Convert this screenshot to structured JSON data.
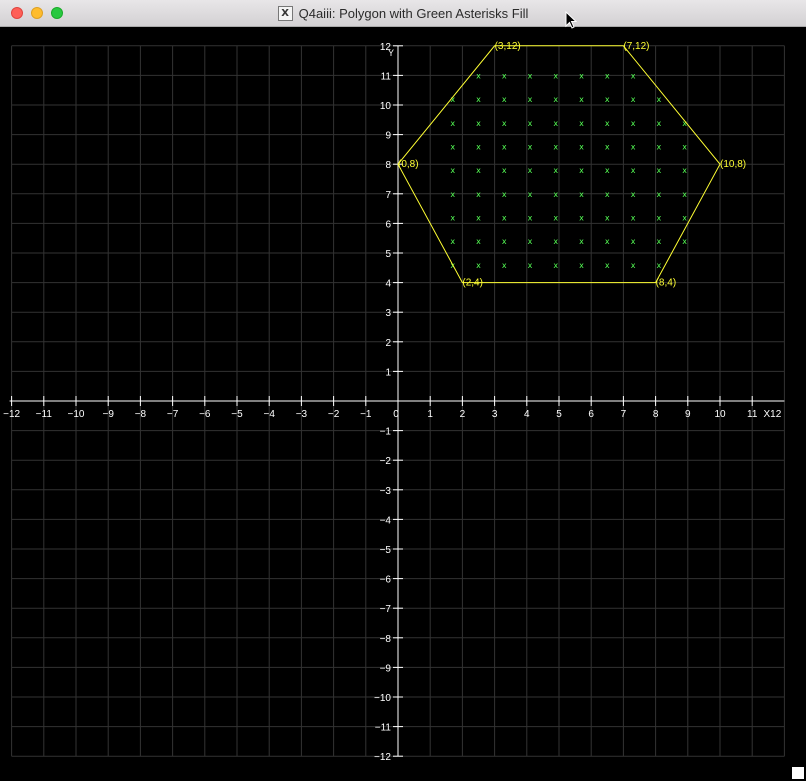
{
  "window": {
    "title": "Q4aiii: Polygon with Green Asterisks Fill",
    "title_icon": "X"
  },
  "colors": {
    "background": "#000000",
    "grid": "#333333",
    "axes": "#ffffff",
    "polygon": "#ffff33",
    "fill_marks": "#55ff55",
    "labels": "#ffffff",
    "vertex_labels": "#ffff33"
  },
  "chart_data": {
    "type": "scatter",
    "xlim": [
      -12,
      12
    ],
    "ylim": [
      -12,
      12
    ],
    "grid": true,
    "x_axis_label": "X12",
    "y_axis_label": "Y",
    "x_ticks": [
      -12,
      -11,
      -10,
      -9,
      -8,
      -7,
      -6,
      -5,
      -4,
      -3,
      -2,
      -1,
      0,
      1,
      2,
      3,
      4,
      5,
      6,
      7,
      8,
      9,
      10,
      11
    ],
    "y_ticks": [
      -12,
      -11,
      -10,
      -9,
      -8,
      -7,
      -6,
      -5,
      -4,
      -3,
      -2,
      -1,
      1,
      2,
      3,
      4,
      5,
      6,
      7,
      8,
      9,
      10,
      11,
      12
    ],
    "polygon": [
      [
        3,
        12
      ],
      [
        7,
        12
      ],
      [
        10,
        8
      ],
      [
        8,
        4
      ],
      [
        2,
        4
      ],
      [
        0,
        8
      ]
    ],
    "vertex_labels": [
      "(3,12)",
      "(7,12)",
      "(10,8)",
      "(8,4)",
      "(2,4)",
      "(0,8)"
    ],
    "fill_marker": "x",
    "fill_points": [
      [
        2.5,
        11
      ],
      [
        3.3,
        11
      ],
      [
        4.1,
        11
      ],
      [
        4.9,
        11
      ],
      [
        5.7,
        11
      ],
      [
        6.5,
        11
      ],
      [
        7.3,
        11
      ],
      [
        1.7,
        10.2
      ],
      [
        2.5,
        10.2
      ],
      [
        3.3,
        10.2
      ],
      [
        4.1,
        10.2
      ],
      [
        4.9,
        10.2
      ],
      [
        5.7,
        10.2
      ],
      [
        6.5,
        10.2
      ],
      [
        7.3,
        10.2
      ],
      [
        8.1,
        10.2
      ],
      [
        1.7,
        9.4
      ],
      [
        2.5,
        9.4
      ],
      [
        3.3,
        9.4
      ],
      [
        4.1,
        9.4
      ],
      [
        4.9,
        9.4
      ],
      [
        5.7,
        9.4
      ],
      [
        6.5,
        9.4
      ],
      [
        7.3,
        9.4
      ],
      [
        8.1,
        9.4
      ],
      [
        8.9,
        9.4
      ],
      [
        1.7,
        8.6
      ],
      [
        2.5,
        8.6
      ],
      [
        3.3,
        8.6
      ],
      [
        4.1,
        8.6
      ],
      [
        4.9,
        8.6
      ],
      [
        5.7,
        8.6
      ],
      [
        6.5,
        8.6
      ],
      [
        7.3,
        8.6
      ],
      [
        8.1,
        8.6
      ],
      [
        8.9,
        8.6
      ],
      [
        1.7,
        7.8
      ],
      [
        2.5,
        7.8
      ],
      [
        3.3,
        7.8
      ],
      [
        4.1,
        7.8
      ],
      [
        4.9,
        7.8
      ],
      [
        5.7,
        7.8
      ],
      [
        6.5,
        7.8
      ],
      [
        7.3,
        7.8
      ],
      [
        8.1,
        7.8
      ],
      [
        8.9,
        7.8
      ],
      [
        1.7,
        7
      ],
      [
        2.5,
        7
      ],
      [
        3.3,
        7
      ],
      [
        4.1,
        7
      ],
      [
        4.9,
        7
      ],
      [
        5.7,
        7
      ],
      [
        6.5,
        7
      ],
      [
        7.3,
        7
      ],
      [
        8.1,
        7
      ],
      [
        8.9,
        7
      ],
      [
        1.7,
        6.2
      ],
      [
        2.5,
        6.2
      ],
      [
        3.3,
        6.2
      ],
      [
        4.1,
        6.2
      ],
      [
        4.9,
        6.2
      ],
      [
        5.7,
        6.2
      ],
      [
        6.5,
        6.2
      ],
      [
        7.3,
        6.2
      ],
      [
        8.1,
        6.2
      ],
      [
        8.9,
        6.2
      ],
      [
        1.7,
        5.4
      ],
      [
        2.5,
        5.4
      ],
      [
        3.3,
        5.4
      ],
      [
        4.1,
        5.4
      ],
      [
        4.9,
        5.4
      ],
      [
        5.7,
        5.4
      ],
      [
        6.5,
        5.4
      ],
      [
        7.3,
        5.4
      ],
      [
        8.1,
        5.4
      ],
      [
        8.9,
        5.4
      ],
      [
        1.7,
        4.6
      ],
      [
        2.5,
        4.6
      ],
      [
        3.3,
        4.6
      ],
      [
        4.1,
        4.6
      ],
      [
        4.9,
        4.6
      ],
      [
        5.7,
        4.6
      ],
      [
        6.5,
        4.6
      ],
      [
        7.3,
        4.6
      ],
      [
        8.1,
        4.6
      ]
    ]
  }
}
